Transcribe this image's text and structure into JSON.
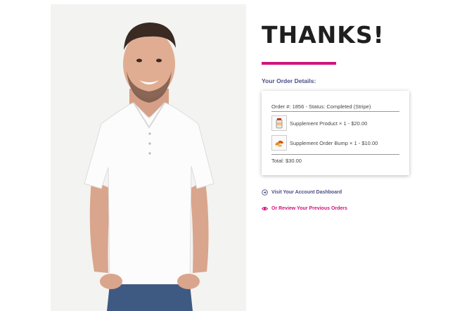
{
  "hero": {
    "image": "smiling-man-white-polo-photo"
  },
  "headline": "THANKS!",
  "colors": {
    "accent": "#d4127f",
    "heading": "#4c4f86",
    "text": "#444444"
  },
  "order": {
    "section_title": "Your Order Details:",
    "summary": "Order #: 1856 - Status: Completed (Stripe)",
    "items": [
      {
        "thumb_icon": "supplement-bottle-icon",
        "label": "Supplement Product × 1 - $20.00"
      },
      {
        "thumb_icon": "supplement-capsules-icon",
        "label": "Supplement Order Bump × 1 - $10.00"
      }
    ],
    "total": "Total: $30.00"
  },
  "links": {
    "dashboard": {
      "icon": "arrow-circle-icon",
      "label": "Visit Your Account Dashboard"
    },
    "orders": {
      "icon": "eye-icon",
      "label": "Or Review Your Previous Orders"
    }
  }
}
